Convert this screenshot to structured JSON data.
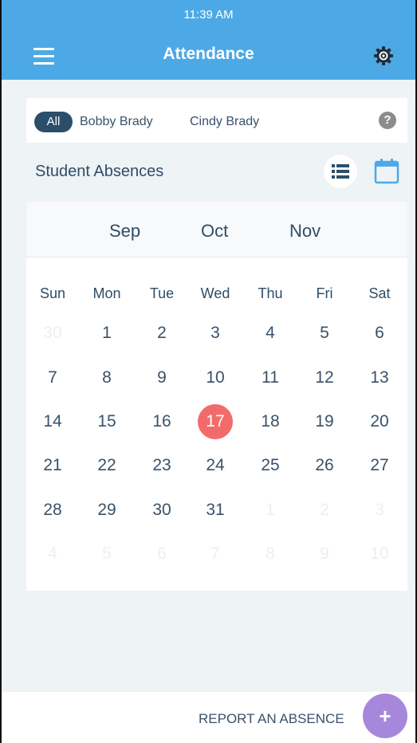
{
  "status_bar": {
    "time": "11:39 AM"
  },
  "header": {
    "title": "Attendance"
  },
  "filters": {
    "all_label": "All",
    "students": [
      "Bobby Brady",
      "Cindy Brady"
    ],
    "help_symbol": "?"
  },
  "section": {
    "title": "Student Absences"
  },
  "calendar": {
    "months": [
      "Sep",
      "Oct",
      "Nov"
    ],
    "weekdays": [
      "Sun",
      "Mon",
      "Tue",
      "Wed",
      "Thu",
      "Fri",
      "Sat"
    ],
    "weeks": [
      [
        30,
        1,
        2,
        3,
        4,
        5,
        6
      ],
      [
        7,
        8,
        9,
        10,
        11,
        12,
        13
      ],
      [
        14,
        15,
        16,
        17,
        18,
        19,
        20
      ],
      [
        21,
        22,
        23,
        24,
        25,
        26,
        27
      ],
      [
        28,
        29,
        30,
        31,
        1,
        2,
        3
      ],
      [
        4,
        5,
        6,
        7,
        8,
        9,
        10
      ]
    ],
    "selected_day": 17,
    "colors": {
      "today": "#f26b6b",
      "text": "#3b5169"
    }
  },
  "footer": {
    "report_label": "REPORT AN ABSENCE",
    "fab_symbol": "+"
  },
  "colors": {
    "header": "#4da9e6",
    "chip_active": "#2b4e6b",
    "fab": "#a787dc"
  }
}
